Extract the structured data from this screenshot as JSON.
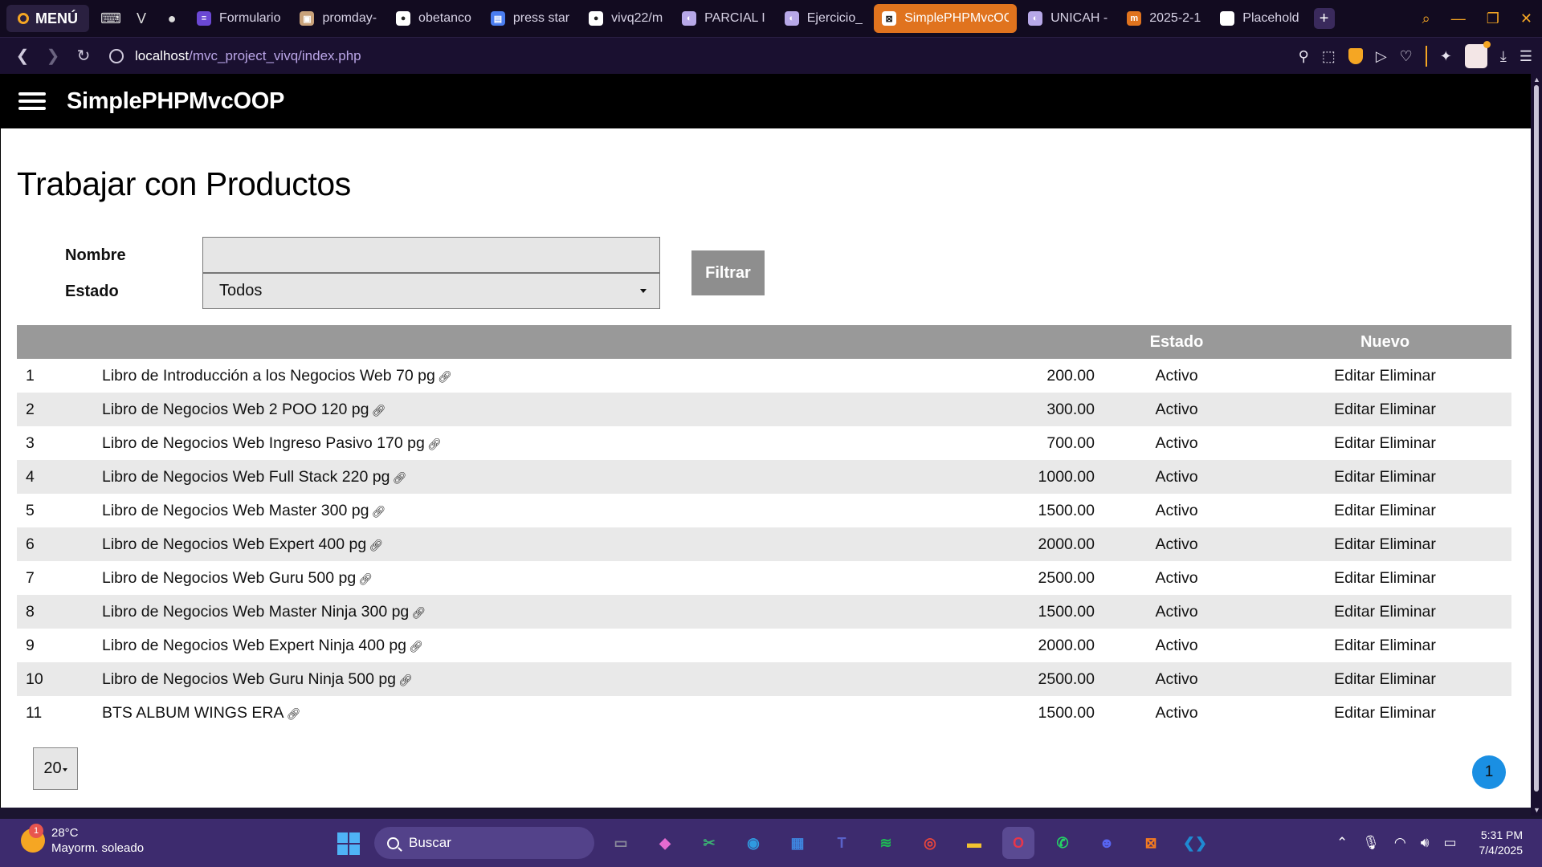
{
  "browser": {
    "menu_label": "MENÚ",
    "tabs": [
      {
        "title": "Formulario",
        "fav_color": "#6b48d4",
        "fav_glyph": "≡"
      },
      {
        "title": "promday-",
        "fav_color": "#c9a27a",
        "fav_glyph": "▣"
      },
      {
        "title": "obetanco",
        "fav_color": "#ffffff",
        "fav_glyph": "●"
      },
      {
        "title": "press star",
        "fav_color": "#4a7df0",
        "fav_glyph": "▤"
      },
      {
        "title": "vivq22/m",
        "fav_color": "#ffffff",
        "fav_glyph": "●"
      },
      {
        "title": "PARCIAL I",
        "fav_color": "#b7a8e8",
        "fav_glyph": "◐"
      },
      {
        "title": "Ejercicio_",
        "fav_color": "#b7a8e8",
        "fav_glyph": "◐"
      },
      {
        "title": "SimplePHPMvcOO",
        "fav_color": "#ffffff",
        "fav_glyph": "⊠",
        "active": true
      },
      {
        "title": "UNICAH -",
        "fav_color": "#b7a8e8",
        "fav_glyph": "◐"
      },
      {
        "title": "2025-2-1",
        "fav_color": "#e0731e",
        "fav_glyph": "m"
      },
      {
        "title": "Placehold",
        "fav_color": "#ffffff",
        "fav_glyph": " "
      }
    ],
    "url_host": "localhost",
    "url_path": "/mvc_project_vivq/index.php"
  },
  "app": {
    "brand": "SimplePHPMvcOOP"
  },
  "page": {
    "title": "Trabajar con Productos",
    "filter": {
      "name_label": "Nombre",
      "name_value": "",
      "status_label": "Estado",
      "status_value": "Todos",
      "button": "Filtrar"
    },
    "table": {
      "headers": {
        "id": "",
        "name": "",
        "price": "",
        "status": "Estado",
        "actions": "Nuevo"
      },
      "edit_label": "Editar",
      "delete_label": "Eliminar",
      "rows": [
        {
          "id": "1",
          "name": "Libro de Introducción a los Negocios Web 70 pg",
          "price": "200.00",
          "status": "Activo"
        },
        {
          "id": "2",
          "name": "Libro de Negocios Web 2 POO 120 pg",
          "price": "300.00",
          "status": "Activo"
        },
        {
          "id": "3",
          "name": "Libro de Negocios Web Ingreso Pasivo 170 pg",
          "price": "700.00",
          "status": "Activo"
        },
        {
          "id": "4",
          "name": "Libro de Negocios Web Full Stack 220 pg",
          "price": "1000.00",
          "status": "Activo"
        },
        {
          "id": "5",
          "name": "Libro de Negocios Web Master 300 pg",
          "price": "1500.00",
          "status": "Activo"
        },
        {
          "id": "6",
          "name": "Libro de Negocios Web Expert 400 pg",
          "price": "2000.00",
          "status": "Activo"
        },
        {
          "id": "7",
          "name": "Libro de Negocios Web Guru 500 pg",
          "price": "2500.00",
          "status": "Activo"
        },
        {
          "id": "8",
          "name": "Libro de Negocios Web Master Ninja 300 pg",
          "price": "1500.00",
          "status": "Activo"
        },
        {
          "id": "9",
          "name": "Libro de Negocios Web Expert Ninja 400 pg",
          "price": "2000.00",
          "status": "Activo"
        },
        {
          "id": "10",
          "name": "Libro de Negocios Web Guru Ninja 500 pg",
          "price": "2500.00",
          "status": "Activo"
        },
        {
          "id": "11",
          "name": "BTS ALBUM WINGS ERA",
          "price": "1500.00",
          "status": "Activo"
        }
      ]
    },
    "pager": {
      "page_size": "20",
      "current_page": "1"
    }
  },
  "taskbar": {
    "weather_temp": "28°C",
    "weather_desc": "Mayorm. soleado",
    "weather_badge": "1",
    "search_placeholder": "Buscar",
    "time": "5:31 PM",
    "date": "7/4/2025",
    "apps": [
      {
        "name": "file-explorer-window-icon",
        "color": "#8a8a9a",
        "glyph": "▭"
      },
      {
        "name": "copilot-icon",
        "color": "#e56bd0",
        "glyph": "◆"
      },
      {
        "name": "snipping-tool-icon",
        "color": "#3bb273",
        "glyph": "✂"
      },
      {
        "name": "edge-icon",
        "color": "#2f9be0",
        "glyph": "◉"
      },
      {
        "name": "store-icon",
        "color": "#3e86e0",
        "glyph": "▦"
      },
      {
        "name": "teams-icon",
        "color": "#5a62c9",
        "glyph": "T"
      },
      {
        "name": "spotify-icon",
        "color": "#1db954",
        "glyph": "≋"
      },
      {
        "name": "chrome-icon",
        "color": "#e8453c",
        "glyph": "◎"
      },
      {
        "name": "folder-icon",
        "color": "#f2c230",
        "glyph": "▬"
      },
      {
        "name": "opera-icon",
        "color": "#e8364a",
        "glyph": "O",
        "active": true
      },
      {
        "name": "whatsapp-icon",
        "color": "#25d366",
        "glyph": "✆"
      },
      {
        "name": "discord-icon",
        "color": "#5865f2",
        "glyph": "☻"
      },
      {
        "name": "xampp-icon",
        "color": "#f57c20",
        "glyph": "⊠"
      },
      {
        "name": "vscode-icon",
        "color": "#1f8ad2",
        "glyph": "❮❯"
      }
    ]
  }
}
